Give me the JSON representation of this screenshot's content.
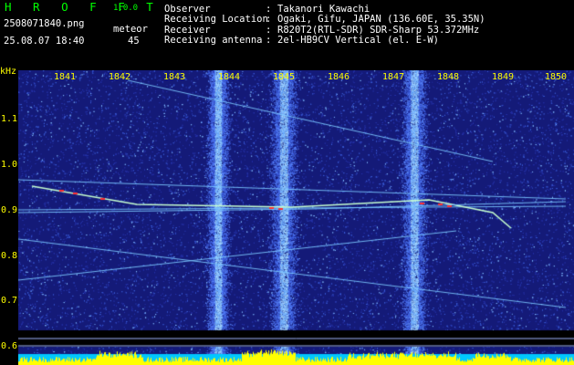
{
  "header": {
    "brand": "H R O F F T",
    "version": "1.0.0",
    "filename": "2508071840.png",
    "datetime": "25.08.07 18:40",
    "meteor_label": "meteor",
    "meteor_count": "45"
  },
  "info": [
    {
      "label": "Observer",
      "value": "Takanori Kawachi"
    },
    {
      "label": "Receiving Location",
      "value": "Ogaki, Gifu, JAPAN (136.60E, 35.35N)"
    },
    {
      "label": "Receiver",
      "value": "R820T2(RTL-SDR) SDR-Sharp 53.372MHz"
    },
    {
      "label": "Receiving antenna",
      "value": "2el-HB9CV Vertical (el. E-W)"
    }
  ],
  "spectrogram": {
    "freq_unit": "kHz",
    "time_ticks": [
      "1841",
      "1842",
      "1843",
      "1844",
      "1845",
      "1846",
      "1847",
      "1848",
      "1849",
      "1850"
    ],
    "freq_ticks": [
      "1.1",
      "1.0",
      "0.9",
      "0.8",
      "0.7",
      "0.6"
    ],
    "colors": {
      "background": "#141a78",
      "axis_text": "#ffff00",
      "meteor_head": "#ff3030",
      "noise_bar": "#ffff00",
      "bottom_band": "#00c8ff"
    }
  }
}
